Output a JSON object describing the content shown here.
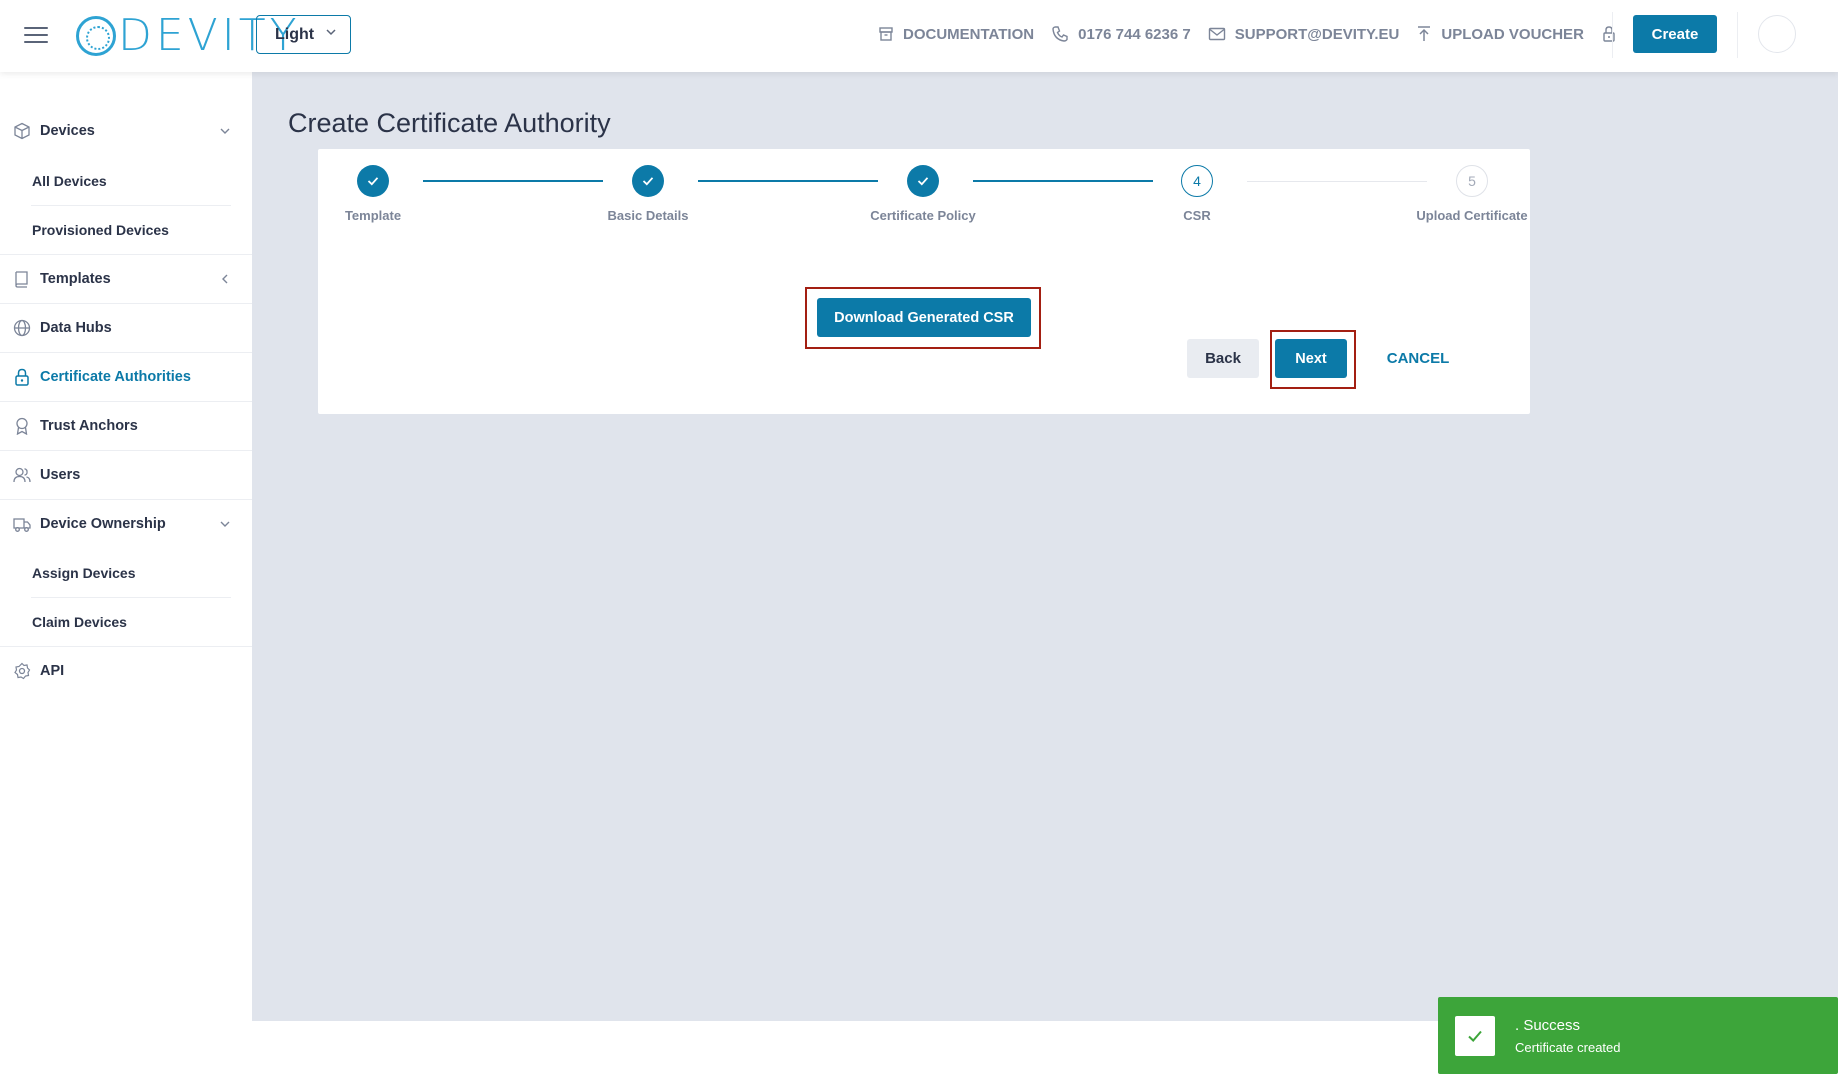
{
  "header": {
    "brand": "DEVITY",
    "theme_select": "Light",
    "links": [
      {
        "label": "DOCUMENTATION",
        "icon": "archive-icon"
      },
      {
        "label": "0176 744 6236 7",
        "icon": "phone-icon"
      },
      {
        "label": "SUPPORT@DEVITY.EU",
        "icon": "mail-icon"
      },
      {
        "label": "UPLOAD VOUCHER",
        "icon": "upload-icon"
      }
    ],
    "create_label": "Create"
  },
  "sidebar": {
    "items": [
      {
        "label": "Devices",
        "icon": "cube-icon"
      },
      {
        "label": "All Devices"
      },
      {
        "label": "Provisioned Devices"
      },
      {
        "label": "Templates",
        "icon": "book-icon"
      },
      {
        "label": "Data Hubs",
        "icon": "globe-icon"
      },
      {
        "label": "Certificate Authorities",
        "icon": "lock-icon",
        "active": true
      },
      {
        "label": "Trust Anchors",
        "icon": "award-icon"
      },
      {
        "label": "Users",
        "icon": "users-icon"
      },
      {
        "label": "Device Ownership",
        "icon": "truck-icon"
      },
      {
        "label": "Assign Devices"
      },
      {
        "label": "Claim Devices"
      },
      {
        "label": "API",
        "icon": "api-gear-icon"
      }
    ]
  },
  "main": {
    "title": "Create Certificate Authority",
    "steps": [
      {
        "label": "Template",
        "status": "done"
      },
      {
        "label": "Basic Details",
        "status": "done"
      },
      {
        "label": "Certificate Policy",
        "status": "done"
      },
      {
        "label": "CSR",
        "number": "4",
        "status": "current"
      },
      {
        "label": "Upload Certificate",
        "number": "5",
        "status": "todo"
      }
    ],
    "download_label": "Download Generated CSR",
    "back_label": "Back",
    "next_label": "Next",
    "cancel_label": "CANCEL"
  },
  "toast": {
    "title": ". Success",
    "message": "Certificate created"
  },
  "colors": {
    "accent": "#0c7aa8",
    "brand": "#2ea3d3",
    "success": "#3da53a",
    "highlight": "#a31f12",
    "background": "#e0e4ec"
  }
}
